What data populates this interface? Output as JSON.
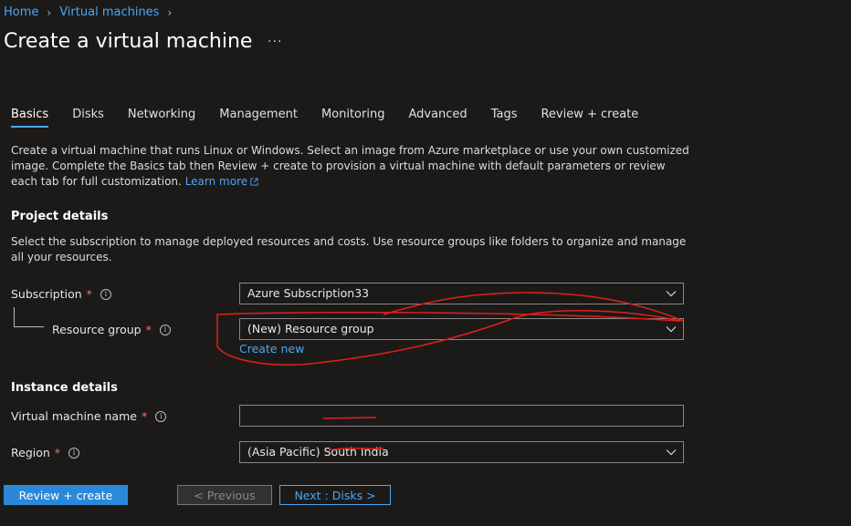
{
  "breadcrumb": {
    "home": "Home",
    "virtual_machines": "Virtual machines"
  },
  "page": {
    "title": "Create a virtual machine",
    "more": "···"
  },
  "tabs": [
    {
      "label": "Basics"
    },
    {
      "label": "Disks"
    },
    {
      "label": "Networking"
    },
    {
      "label": "Management"
    },
    {
      "label": "Monitoring"
    },
    {
      "label": "Advanced"
    },
    {
      "label": "Tags"
    },
    {
      "label": "Review + create"
    }
  ],
  "intro": {
    "text": "Create a virtual machine that runs Linux or Windows. Select an image from Azure marketplace or use your own customized image. Complete the Basics tab then Review + create to provision a virtual machine with default parameters or review each tab for full customization.",
    "learn_more": "Learn more"
  },
  "project_details": {
    "title": "Project details",
    "description": "Select the subscription to manage deployed resources and costs. Use resource groups like folders to organize and manage all your resources.",
    "subscription_label": "Subscription",
    "subscription_value": "Azure Subscription33",
    "resource_group_label": "Resource group",
    "resource_group_value": "(New) Resource group",
    "create_new": "Create new"
  },
  "instance_details": {
    "title": "Instance details",
    "vm_name_label": "Virtual machine name",
    "vm_name_value": "",
    "region_label": "Region",
    "region_value": "(Asia Pacific) South India"
  },
  "required_marker": "*",
  "info_glyph": "i",
  "footer": {
    "review_create": "Review + create",
    "previous": "< Previous",
    "next": "Next : Disks >"
  },
  "colors": {
    "accent": "#4ca7f5",
    "primary_button": "#2b88d8",
    "annotation": "#e0201b",
    "required": "#f1707b"
  },
  "icons": {
    "chevron": "chevron-down-icon",
    "info": "info-icon",
    "external": "external-link-icon",
    "separator": "chevron-right-icon"
  }
}
